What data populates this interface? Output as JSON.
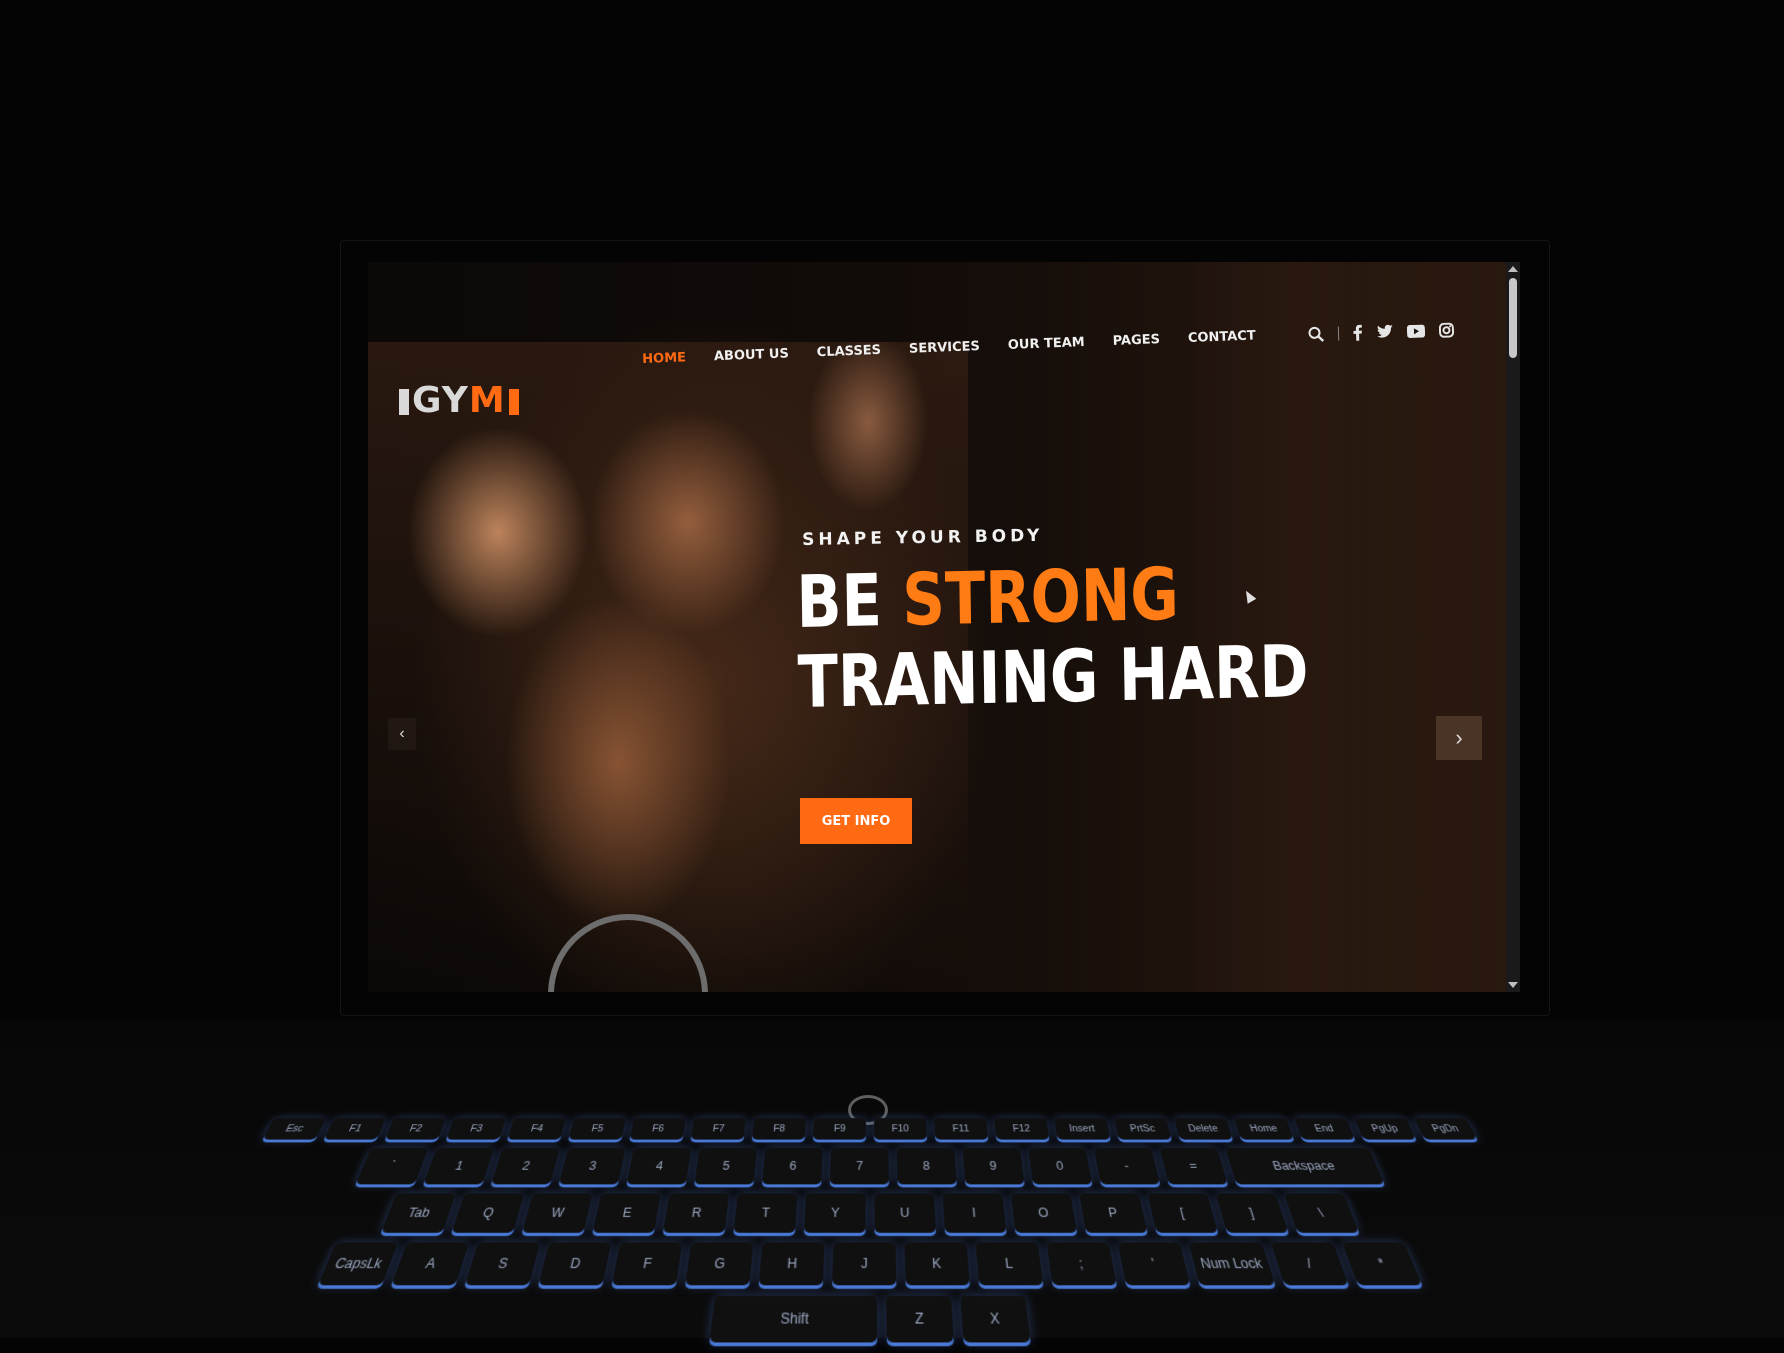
{
  "logo": {
    "text_left": "GY",
    "text_accent": "M"
  },
  "nav": {
    "items": [
      {
        "label": "HOME",
        "active": true
      },
      {
        "label": "ABOUT US",
        "active": false
      },
      {
        "label": "CLASSES",
        "active": false
      },
      {
        "label": "SERVICES",
        "active": false
      },
      {
        "label": "OUR TEAM",
        "active": false
      },
      {
        "label": "PAGES",
        "active": false
      },
      {
        "label": "CONTACT",
        "active": false
      }
    ]
  },
  "header_icons": [
    "search-icon",
    "facebook-icon",
    "twitter-icon",
    "youtube-icon",
    "instagram-icon"
  ],
  "hero": {
    "tagline": "SHAPE YOUR BODY",
    "headline_line1_plain": "BE",
    "headline_line1_accent": "STRONG",
    "headline_line2": "TRANING HARD",
    "cta_label": "GET INFO",
    "prev_icon": "‹",
    "next_icon": "›"
  },
  "colors": {
    "accent": "#ff6a13",
    "text": "#ffffff",
    "background": "#0b0806"
  },
  "keyboard": {
    "row_fn": [
      "Esc",
      "F1",
      "F2",
      "F3",
      "F4",
      "F5",
      "F6",
      "F7",
      "F8",
      "F9",
      "F10",
      "F11",
      "F12",
      "Insert",
      "PrtSc",
      "Delete",
      "Home",
      "End",
      "PgUp",
      "PgDn"
    ],
    "row_num": [
      "`",
      "1",
      "2",
      "3",
      "4",
      "5",
      "6",
      "7",
      "8",
      "9",
      "0",
      "-",
      "=",
      "Backspace"
    ],
    "row_q": [
      "Tab",
      "Q",
      "W",
      "E",
      "R",
      "T",
      "Y",
      "U",
      "I",
      "O",
      "P",
      "[",
      "]",
      "\\"
    ],
    "row_a": [
      "CapsLk",
      "A",
      "S",
      "D",
      "F",
      "G",
      "H",
      "J",
      "K",
      "L",
      ";",
      "'",
      "Num Lock",
      "/",
      "*"
    ],
    "row_z": [
      "Shift",
      "Z",
      "X"
    ]
  }
}
